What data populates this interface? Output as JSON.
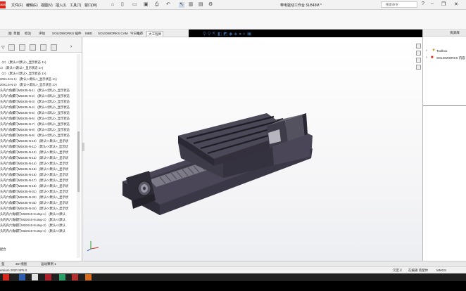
{
  "app": {
    "logo_text": "3DS",
    "document_title": "带电驱动工作台 SLB43M *",
    "search_placeholder": "搜索命令",
    "menus": [
      "文件(F)",
      "编辑(E)",
      "视图(V)",
      "插入(I)",
      "工具(T)",
      "窗口(W)"
    ]
  },
  "command_tabs": [
    "图",
    "草图",
    "标注",
    "评估",
    "SOLIDWORKS 插件",
    "MBD",
    "SOLIDWORKS CAM",
    "今日推荐",
    "大工程师"
  ],
  "active_tab_index": 8,
  "feature_tree": {
    "rows": [
      "〈2〉 (默认<<默认>_显示状态 1>)",
      "1〉 (默认<<默认>_显示状态 1>)",
      "〈2〉 (默认<<默认>_显示状态 1>)",
      "20X1.5-N-1〉 (默认<<默认>_显示状态 1>)",
      "20X1.5-N-2〉 (默认<<默认>_显示状态 1>)",
      "头内六角螺钉M5X35-N-1〉 (默认<<默认>_显示状态",
      "头内六角螺钉M5X35-N-2〉 (默认<<默认>_显示状态",
      "头内六角螺钉M5X35-N-3〉 (默认<<默认>_显示状态",
      "头内六角螺钉M5X35-N-4〉 (默认<<默认>_显示状态",
      "头内六角螺钉M5X35-N-5〉 (默认<<默认>_显示状态",
      "头内六角螺钉M5X35-N-6〉 (默认<<默认>_显示状态",
      "头内六角螺钉M5X35-N-7〉 (默认<<默认>_显示状态",
      "头内六角螺钉M5X35-N-8〉 (默认<<默认>_显示状态",
      "头内六角螺钉M5X35-N-9〉 (默认<<默认>_显示状态",
      "头内六角螺钉M5X35-N-10〉 (默认<<默认>_显示状",
      "头内六角螺钉M5X35-N-11〉 (默认<<默认>_显示状",
      "头内六角螺钉M5X35-N-12〉 (默认<<默认>_显示状",
      "头内六角螺钉M5X35-N-13〉 (默认<<默认>_显示状",
      "头内六角螺钉M5X35-N-14〉 (默认<<默认>_显示状",
      "头内六角螺钉M5X35-N-15〉 (默认<<默认>_显示状",
      "头内六角螺钉M5X35-N-16〉 (默认<<默认>_显示状",
      "头内六角螺钉M5X35-N-17〉 (默认<<默认>_显示状",
      "头内六角螺钉M5X35-N-18〉 (默认<<默认>_显示状",
      "头内六角螺钉M5X35-N-31〉 (默认<<默认>_显示状",
      "头内六角螺钉M5X35-N-32〉 (默认<<默认>_显示状",
      "头内六角螺钉M5X35-N-33〉 (默认<<默认>_显示状",
      "头内六角螺钉M5X35-N-34〉 (默认<<默认>_显示状",
      "头的内六角螺钉M10X40-N.step-1〉 (默认<<默认",
      "头的内六角螺钉M10X40-N.step-2〉 (默认<<默认",
      "头的内六角螺钉M10X40-N.step-3〉 (默认<<默认",
      "头的内六角螺钉M10X40-N.step-4〉 (默认<<默认"
    ],
    "footer": "配合"
  },
  "task_pane": {
    "header": "资源库",
    "items": [
      "Toolbox",
      "SOLIDWORKS 内容"
    ]
  },
  "bottom_tabs": [
    "型",
    "3D 视图",
    "运动算例 1"
  ],
  "status": {
    "left": "emium 2020 SP5.0",
    "state": "欠定义",
    "mode": "在编辑 装配体",
    "units": "MMGS"
  },
  "colors": {
    "accent": "#d8261c",
    "model_body": "#4a4658",
    "model_dark": "#2a2832",
    "model_light": "#7d7a88"
  }
}
